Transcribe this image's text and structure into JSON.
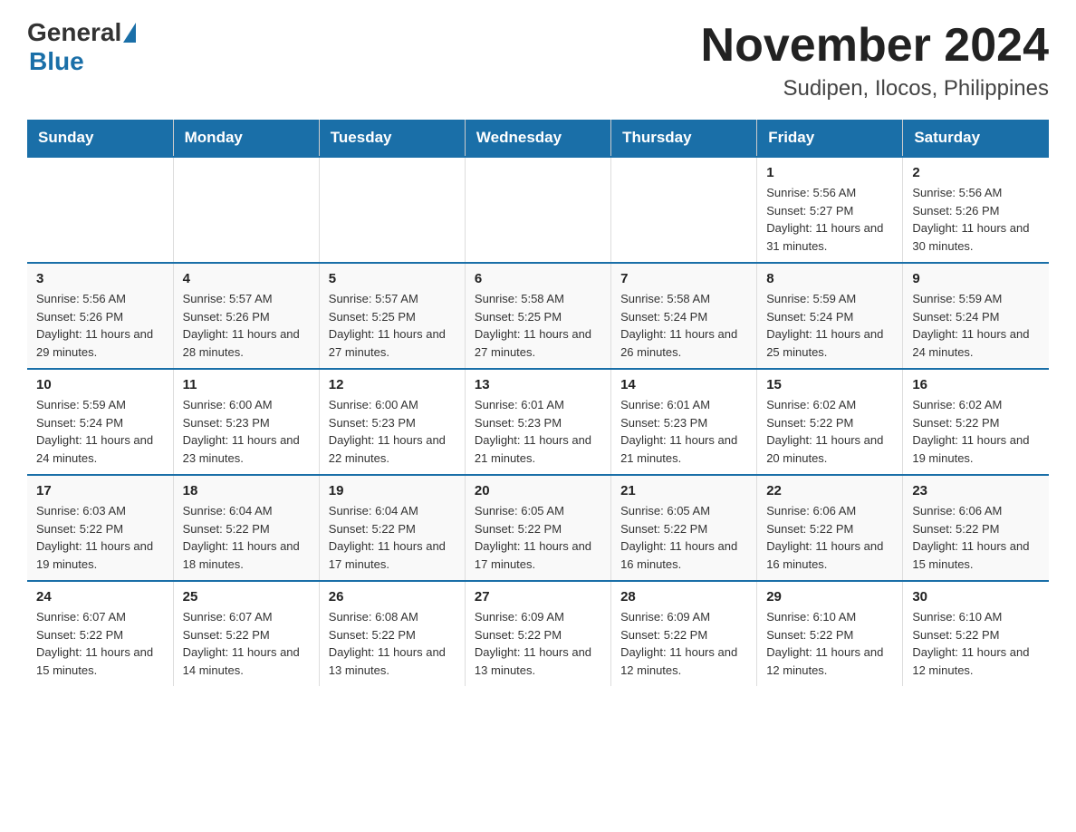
{
  "header": {
    "logo": {
      "general": "General",
      "blue": "Blue",
      "triangle": "▲"
    },
    "title": "November 2024",
    "location": "Sudipen, Ilocos, Philippines"
  },
  "days_of_week": [
    "Sunday",
    "Monday",
    "Tuesday",
    "Wednesday",
    "Thursday",
    "Friday",
    "Saturday"
  ],
  "weeks": [
    [
      {
        "day": "",
        "info": ""
      },
      {
        "day": "",
        "info": ""
      },
      {
        "day": "",
        "info": ""
      },
      {
        "day": "",
        "info": ""
      },
      {
        "day": "",
        "info": ""
      },
      {
        "day": "1",
        "info": "Sunrise: 5:56 AM\nSunset: 5:27 PM\nDaylight: 11 hours and 31 minutes."
      },
      {
        "day": "2",
        "info": "Sunrise: 5:56 AM\nSunset: 5:26 PM\nDaylight: 11 hours and 30 minutes."
      }
    ],
    [
      {
        "day": "3",
        "info": "Sunrise: 5:56 AM\nSunset: 5:26 PM\nDaylight: 11 hours and 29 minutes."
      },
      {
        "day": "4",
        "info": "Sunrise: 5:57 AM\nSunset: 5:26 PM\nDaylight: 11 hours and 28 minutes."
      },
      {
        "day": "5",
        "info": "Sunrise: 5:57 AM\nSunset: 5:25 PM\nDaylight: 11 hours and 27 minutes."
      },
      {
        "day": "6",
        "info": "Sunrise: 5:58 AM\nSunset: 5:25 PM\nDaylight: 11 hours and 27 minutes."
      },
      {
        "day": "7",
        "info": "Sunrise: 5:58 AM\nSunset: 5:24 PM\nDaylight: 11 hours and 26 minutes."
      },
      {
        "day": "8",
        "info": "Sunrise: 5:59 AM\nSunset: 5:24 PM\nDaylight: 11 hours and 25 minutes."
      },
      {
        "day": "9",
        "info": "Sunrise: 5:59 AM\nSunset: 5:24 PM\nDaylight: 11 hours and 24 minutes."
      }
    ],
    [
      {
        "day": "10",
        "info": "Sunrise: 5:59 AM\nSunset: 5:24 PM\nDaylight: 11 hours and 24 minutes."
      },
      {
        "day": "11",
        "info": "Sunrise: 6:00 AM\nSunset: 5:23 PM\nDaylight: 11 hours and 23 minutes."
      },
      {
        "day": "12",
        "info": "Sunrise: 6:00 AM\nSunset: 5:23 PM\nDaylight: 11 hours and 22 minutes."
      },
      {
        "day": "13",
        "info": "Sunrise: 6:01 AM\nSunset: 5:23 PM\nDaylight: 11 hours and 21 minutes."
      },
      {
        "day": "14",
        "info": "Sunrise: 6:01 AM\nSunset: 5:23 PM\nDaylight: 11 hours and 21 minutes."
      },
      {
        "day": "15",
        "info": "Sunrise: 6:02 AM\nSunset: 5:22 PM\nDaylight: 11 hours and 20 minutes."
      },
      {
        "day": "16",
        "info": "Sunrise: 6:02 AM\nSunset: 5:22 PM\nDaylight: 11 hours and 19 minutes."
      }
    ],
    [
      {
        "day": "17",
        "info": "Sunrise: 6:03 AM\nSunset: 5:22 PM\nDaylight: 11 hours and 19 minutes."
      },
      {
        "day": "18",
        "info": "Sunrise: 6:04 AM\nSunset: 5:22 PM\nDaylight: 11 hours and 18 minutes."
      },
      {
        "day": "19",
        "info": "Sunrise: 6:04 AM\nSunset: 5:22 PM\nDaylight: 11 hours and 17 minutes."
      },
      {
        "day": "20",
        "info": "Sunrise: 6:05 AM\nSunset: 5:22 PM\nDaylight: 11 hours and 17 minutes."
      },
      {
        "day": "21",
        "info": "Sunrise: 6:05 AM\nSunset: 5:22 PM\nDaylight: 11 hours and 16 minutes."
      },
      {
        "day": "22",
        "info": "Sunrise: 6:06 AM\nSunset: 5:22 PM\nDaylight: 11 hours and 16 minutes."
      },
      {
        "day": "23",
        "info": "Sunrise: 6:06 AM\nSunset: 5:22 PM\nDaylight: 11 hours and 15 minutes."
      }
    ],
    [
      {
        "day": "24",
        "info": "Sunrise: 6:07 AM\nSunset: 5:22 PM\nDaylight: 11 hours and 15 minutes."
      },
      {
        "day": "25",
        "info": "Sunrise: 6:07 AM\nSunset: 5:22 PM\nDaylight: 11 hours and 14 minutes."
      },
      {
        "day": "26",
        "info": "Sunrise: 6:08 AM\nSunset: 5:22 PM\nDaylight: 11 hours and 13 minutes."
      },
      {
        "day": "27",
        "info": "Sunrise: 6:09 AM\nSunset: 5:22 PM\nDaylight: 11 hours and 13 minutes."
      },
      {
        "day": "28",
        "info": "Sunrise: 6:09 AM\nSunset: 5:22 PM\nDaylight: 11 hours and 12 minutes."
      },
      {
        "day": "29",
        "info": "Sunrise: 6:10 AM\nSunset: 5:22 PM\nDaylight: 11 hours and 12 minutes."
      },
      {
        "day": "30",
        "info": "Sunrise: 6:10 AM\nSunset: 5:22 PM\nDaylight: 11 hours and 12 minutes."
      }
    ]
  ]
}
